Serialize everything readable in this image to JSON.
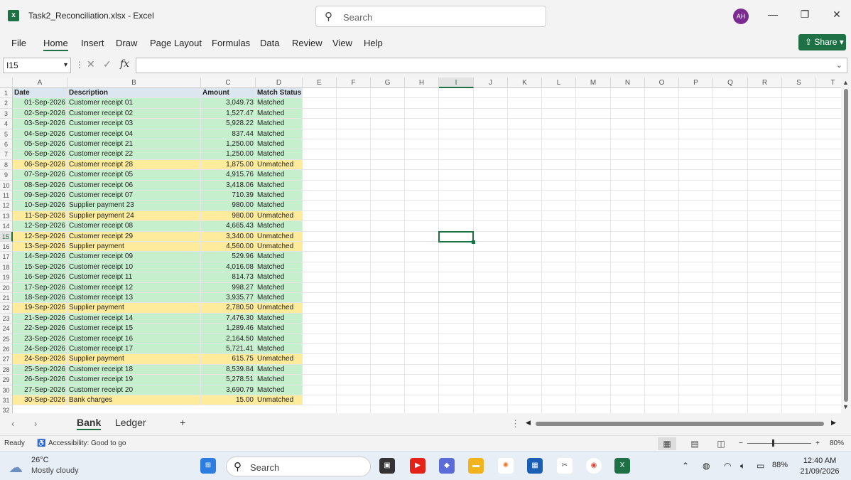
{
  "window": {
    "title": "Task2_Reconciliation.xlsx  -  Excel",
    "search_placeholder": "Search",
    "user_initials": "AH"
  },
  "menu": [
    "File",
    "Home",
    "Insert",
    "Draw",
    "Page Layout",
    "Formulas",
    "Data",
    "Review",
    "View",
    "Help"
  ],
  "share_label": "Share",
  "name_box": "I15",
  "formula": "",
  "columns": [
    "A",
    "B",
    "C",
    "D",
    "E",
    "F",
    "G",
    "H",
    "I",
    "J",
    "K",
    "L",
    "M",
    "N",
    "O",
    "P",
    "Q",
    "R",
    "S",
    "T"
  ],
  "selected_column": "I",
  "selected_row": 15,
  "header_row": [
    "Date",
    "Description",
    "Amount",
    "Match Status"
  ],
  "rows": [
    [
      "01-Sep-2026",
      "Customer receipt 01",
      "3,049.73",
      "Matched"
    ],
    [
      "02-Sep-2026",
      "Customer receipt 02",
      "1,527.47",
      "Matched"
    ],
    [
      "03-Sep-2026",
      "Customer receipt 03",
      "5,928.22",
      "Matched"
    ],
    [
      "04-Sep-2026",
      "Customer receipt 04",
      "837.44",
      "Matched"
    ],
    [
      "05-Sep-2026",
      "Customer receipt 21",
      "1,250.00",
      "Matched"
    ],
    [
      "06-Sep-2026",
      "Customer receipt 22",
      "1,250.00",
      "Matched"
    ],
    [
      "06-Sep-2026",
      "Customer receipt 28",
      "1,875.00",
      "Unmatched"
    ],
    [
      "07-Sep-2026",
      "Customer receipt 05",
      "4,915.76",
      "Matched"
    ],
    [
      "08-Sep-2026",
      "Customer receipt 06",
      "3,418.06",
      "Matched"
    ],
    [
      "09-Sep-2026",
      "Customer receipt 07",
      "710.39",
      "Matched"
    ],
    [
      "10-Sep-2026",
      "Supplier payment 23",
      "980.00",
      "Matched"
    ],
    [
      "11-Sep-2026",
      "Supplier payment 24",
      "980.00",
      "Unmatched"
    ],
    [
      "12-Sep-2026",
      "Customer receipt 08",
      "4,665.43",
      "Matched"
    ],
    [
      "12-Sep-2026",
      "Customer receipt 29",
      "3,340.00",
      "Unmatched"
    ],
    [
      "13-Sep-2026",
      "Supplier payment",
      "4,560.00",
      "Unmatched"
    ],
    [
      "14-Sep-2026",
      "Customer receipt 09",
      "529.96",
      "Matched"
    ],
    [
      "15-Sep-2026",
      "Customer receipt 10",
      "4,016.08",
      "Matched"
    ],
    [
      "16-Sep-2026",
      "Customer receipt 11",
      "814.73",
      "Matched"
    ],
    [
      "17-Sep-2026",
      "Customer receipt 12",
      "998.27",
      "Matched"
    ],
    [
      "18-Sep-2026",
      "Customer receipt 13",
      "3,935.77",
      "Matched"
    ],
    [
      "19-Sep-2026",
      "Supplier payment",
      "2,780.50",
      "Unmatched"
    ],
    [
      "21-Sep-2026",
      "Customer receipt 14",
      "7,476.30",
      "Matched"
    ],
    [
      "22-Sep-2026",
      "Customer receipt 15",
      "1,289.46",
      "Matched"
    ],
    [
      "23-Sep-2026",
      "Customer receipt 16",
      "2,164.50",
      "Matched"
    ],
    [
      "24-Sep-2026",
      "Customer receipt 17",
      "5,721.41",
      "Matched"
    ],
    [
      "24-Sep-2026",
      "Supplier payment",
      "615.75",
      "Unmatched"
    ],
    [
      "25-Sep-2026",
      "Customer receipt 18",
      "8,539.84",
      "Matched"
    ],
    [
      "26-Sep-2026",
      "Customer receipt 19",
      "5,278.51",
      "Matched"
    ],
    [
      "27-Sep-2026",
      "Customer receipt 20",
      "3,690.79",
      "Matched"
    ],
    [
      "30-Sep-2026",
      "Bank charges",
      "15.00",
      "Unmatched"
    ]
  ],
  "colors": {
    "matched": "#c6efce",
    "unmatched": "#ffeb9c",
    "header_bg": "#dce6f1",
    "accent": "#1e7145"
  },
  "sheets": [
    {
      "name": "Bank",
      "active": true
    },
    {
      "name": "Ledger",
      "active": false
    }
  ],
  "add_sheet_label": "+",
  "status": {
    "ready": "Ready",
    "accessibility": "Accessibility: Good to go",
    "zoom": "80%"
  },
  "taskbar": {
    "temperature": "26°C",
    "weather": "Mostly cloudy",
    "search_label": "Search",
    "battery": "88%",
    "time": "12:40 AM",
    "date": "21/09/2026"
  }
}
